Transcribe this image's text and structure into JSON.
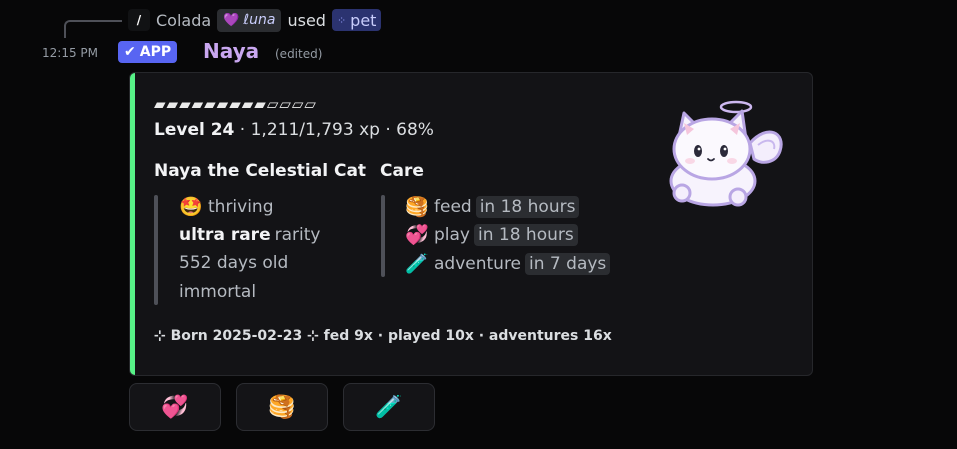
{
  "reply": {
    "command_glyph": "/",
    "user": "Colada",
    "tag_icon": "purple-heart-icon",
    "tag_label": "ℓuna",
    "used_text": "used",
    "command_name": "pet"
  },
  "message": {
    "timestamp": "12:15 PM",
    "app_badge": "APP",
    "author": "Naya",
    "edited": "(edited)"
  },
  "embed": {
    "accent_color": "#57f287",
    "progress_bar": "▰▰▰▰▰▰▰▰▰▱▱▱▱",
    "progress_fraction": 0.68,
    "level_label": "Level 24",
    "xp_text": "· 1,211/1,793 xp · 68%",
    "fields": [
      {
        "title": "Naya the Celestial Cat",
        "lines": [
          {
            "emoji": "🤩",
            "bold": "",
            "text": "thriving"
          },
          {
            "emoji": "",
            "bold": "ultra rare",
            "text": "rarity"
          },
          {
            "emoji": "",
            "bold": "",
            "text": "552 days old"
          },
          {
            "emoji": "",
            "bold": "",
            "text": "immortal"
          }
        ]
      },
      {
        "title": "Care",
        "lines": [
          {
            "emoji": "🥞",
            "text": "feed",
            "code": "in 18 hours"
          },
          {
            "emoji": "💞",
            "text": "play",
            "code": "in 18 hours"
          },
          {
            "emoji": "🧪",
            "text": "adventure",
            "code": "in 7 days"
          }
        ]
      }
    ],
    "footer": "⊹ Born 2025-02-23 ⊹ fed 9x · played 10x · adventures 16x",
    "thumbnail": "celestial-cat-image"
  },
  "buttons": [
    {
      "icon": "💞",
      "name": "play-button"
    },
    {
      "icon": "🥞",
      "name": "feed-button"
    },
    {
      "icon": "🧪",
      "name": "adventure-button"
    }
  ]
}
